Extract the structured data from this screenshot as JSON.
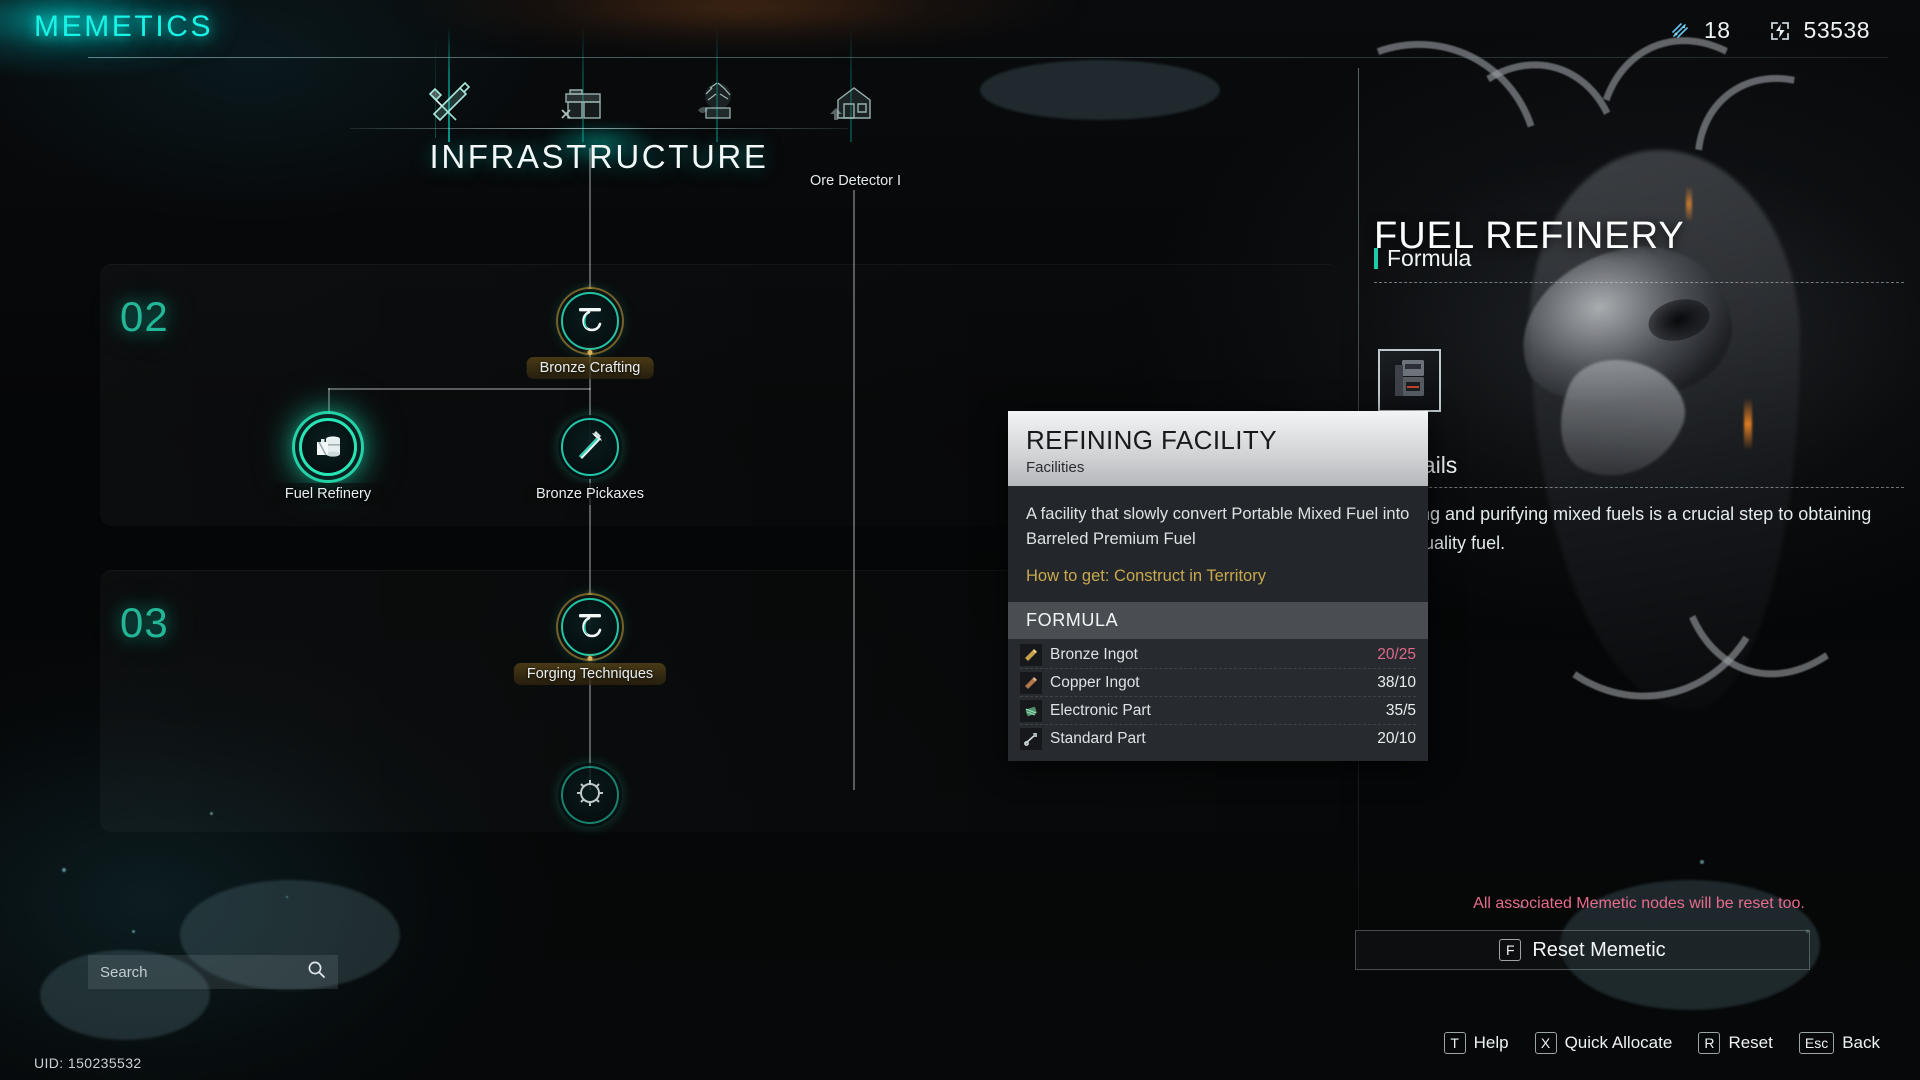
{
  "header": {
    "title": "MEMETICS",
    "currencies": [
      {
        "icon": "shard-icon",
        "value": "18"
      },
      {
        "icon": "energy-icon",
        "value": "53538"
      }
    ]
  },
  "tabs": {
    "items": [
      {
        "name": "tab-tools",
        "icon": "pickaxe-sword-icon",
        "active": true
      },
      {
        "name": "tab-workbench",
        "icon": "workbench-icon",
        "active": false
      },
      {
        "name": "tab-agriculture",
        "icon": "plant-icon",
        "active": false
      },
      {
        "name": "tab-construction",
        "icon": "house-icon",
        "active": false
      }
    ],
    "section_heading": "INFRASTRUCTURE"
  },
  "tree": {
    "tiers": [
      {
        "label": "02"
      },
      {
        "label": "03"
      }
    ],
    "floating_labels": [
      {
        "text": "Ore Detector I"
      }
    ],
    "nodes": [
      {
        "label": "Bronze Crafting",
        "icon": "forge-icon",
        "state": "gold"
      },
      {
        "label": "Fuel Refinery",
        "icon": "barrel-icon",
        "state": "selected"
      },
      {
        "label": "Bronze Pickaxes",
        "icon": "pickaxe-icon",
        "state": "unlocked"
      },
      {
        "label": "Forging Techniques",
        "icon": "forge-icon",
        "state": "gold"
      }
    ]
  },
  "search": {
    "placeholder": "Search",
    "value": "",
    "icon": "search-icon"
  },
  "footer": {
    "uid": "UID: 150235532"
  },
  "detail": {
    "title": "FUEL REFINERY",
    "formula_heading": "Formula",
    "formula_item_icon": "refining-facility-icon",
    "details_heading": "Details",
    "body": "Refining and purifying mixed fuels is a crucial step to obtaining high-quality fuel.",
    "reset_warning": "All associated Memetic nodes will be reset too.",
    "reset_button": {
      "key": "F",
      "label": "Reset Memetic"
    }
  },
  "keyhints": [
    {
      "key": "T",
      "label": "Help"
    },
    {
      "key": "X",
      "label": "Quick Allocate"
    },
    {
      "key": "R",
      "label": "Reset"
    },
    {
      "key": "Esc",
      "label": "Back"
    }
  ],
  "tooltip": {
    "title": "REFINING FACILITY",
    "subtitle": "Facilities",
    "description": "A facility that slowly convert Portable Mixed Fuel into Barreled Premium Fuel",
    "how_to_get": "How to get: Construct in Territory",
    "formula_heading": "FORMULA",
    "formula": [
      {
        "icon": "bronze-ingot-icon",
        "name": "Bronze Ingot",
        "qty": "20/25",
        "insufficient": true
      },
      {
        "icon": "copper-ingot-icon",
        "name": "Copper Ingot",
        "qty": "38/10",
        "insufficient": false
      },
      {
        "icon": "electronic-part-icon",
        "name": "Electronic Part",
        "qty": "35/5",
        "insufficient": false
      },
      {
        "icon": "standard-part-icon",
        "name": "Standard Part",
        "qty": "20/10",
        "insufficient": false
      }
    ]
  },
  "colors": {
    "accent_teal": "#19f3e6",
    "node_teal": "#21c6a6",
    "tier_teal": "#23b697",
    "gold": "#c9a94e",
    "warning_red": "#e86b8c"
  }
}
